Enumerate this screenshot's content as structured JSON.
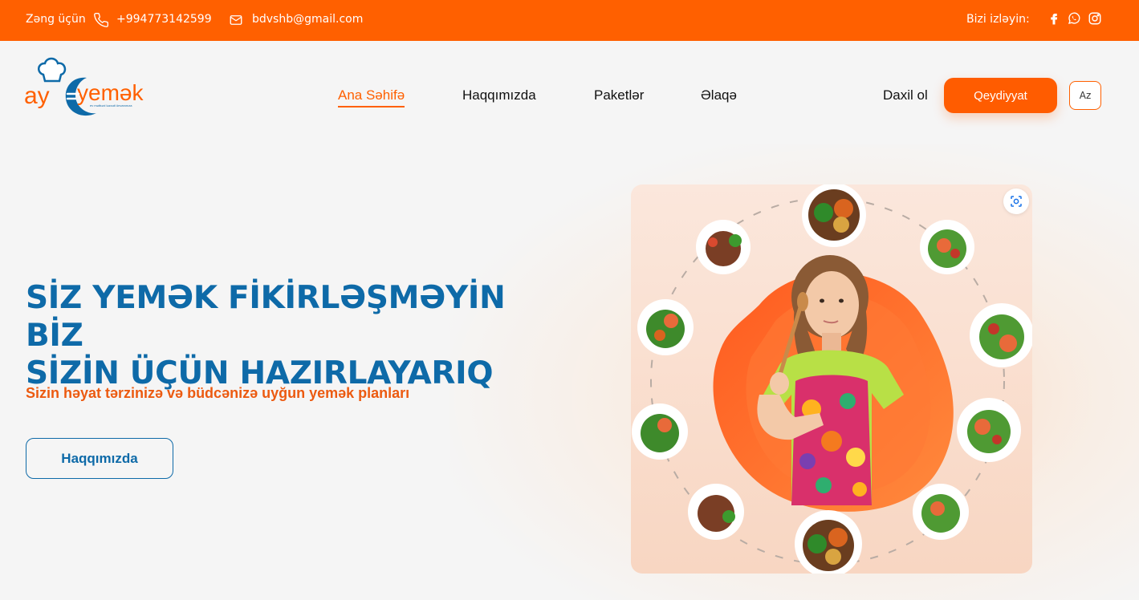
{
  "topbar": {
    "call_label": "Zəng üçün",
    "phone": "+994773142599",
    "email": "bdvshb@gmail.com",
    "follow_label": "Bizi izləyin:",
    "social_icons": [
      "facebook-icon",
      "whatsapp-icon",
      "instagram-icon"
    ]
  },
  "nav": {
    "logo_text_a": "ay",
    "logo_text_b": "yemək",
    "logo_tagline": "ev mətbəxi ləzzəti ünvanınıza",
    "items": [
      {
        "label": "Ana Səhifə",
        "active": true
      },
      {
        "label": "Haqqımızda",
        "active": false
      },
      {
        "label": "Paketlər",
        "active": false
      },
      {
        "label": "Əlaqə",
        "active": false
      }
    ],
    "login": "Daxil ol",
    "register": "Qeydiyyat",
    "lang": "Az"
  },
  "hero": {
    "title_line1": "SİZ YEMƏK FİKİRLƏŞMƏYİN BİZ",
    "title_line2": "SİZİN ÜÇÜN HAZIRLAYARIQ",
    "subtitle": "Sizin həyat tərzinizə və büdcənizə uyğun yemək planları",
    "button": "Haqqımızda"
  },
  "colors": {
    "accent": "#ff6000",
    "primary_blue": "#0e6aa8",
    "subtitle_orange": "#ec5a10"
  }
}
